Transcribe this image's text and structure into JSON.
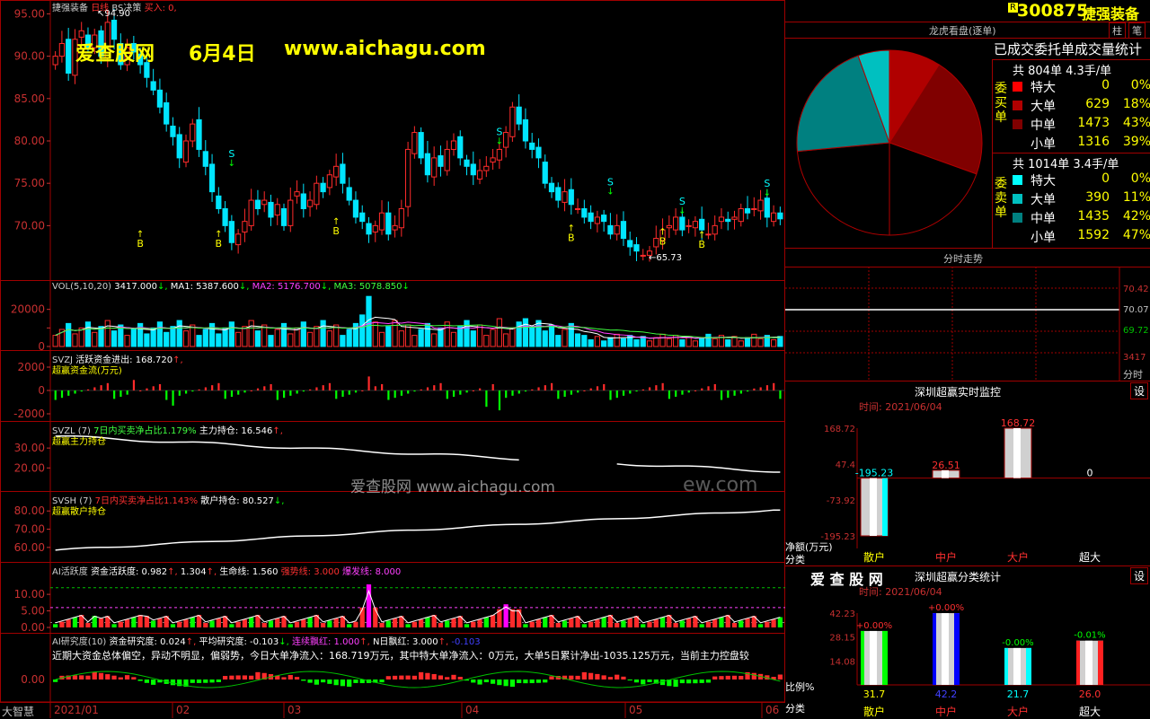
{
  "colors": {
    "up": "#ff2b2b",
    "down": "#00e5ff",
    "frame": "#a00000",
    "axis": "#c83030",
    "yellow": "#ffff00",
    "white": "#ffffff",
    "green": "#00ff00",
    "magenta": "#ff00ff"
  },
  "main": {
    "title": "捷强装备",
    "period": "日线",
    "indicator": "BS决策",
    "buy_label": "买入: 0,",
    "watermark_site": "爱查股网",
    "watermark_date": "6月4日",
    "watermark_url": "www.aichagu.com",
    "high_label": "94.90",
    "low_label": "65.73",
    "y_ticks": [
      "95.00",
      "90.00",
      "85.00",
      "80.00",
      "75.00",
      "70.00"
    ],
    "y_values": [
      95,
      90,
      85,
      80,
      75,
      70
    ],
    "b_marks": [
      [
        13,
        69.5
      ],
      [
        25,
        69.5
      ],
      [
        43,
        71
      ],
      [
        79,
        70.2
      ],
      [
        93,
        69.8
      ],
      [
        99,
        69.4
      ]
    ],
    "s_marks": [
      [
        27,
        76.8
      ],
      [
        68,
        79.4
      ],
      [
        85,
        73.5
      ],
      [
        96,
        71.2
      ],
      [
        109,
        73.3
      ]
    ]
  },
  "chart_data": [
    {
      "type": "candlestick",
      "title": "捷强装备 日线",
      "ylim": [
        64,
        96
      ],
      "closes": [
        90,
        91.5,
        88,
        92,
        93,
        91,
        92.5,
        90,
        94,
        92,
        89,
        91,
        90.5,
        89,
        87.5,
        86,
        84,
        82,
        80.5,
        78,
        80,
        82,
        79,
        77,
        74,
        72,
        70,
        68,
        69,
        70.5,
        73,
        72,
        73,
        71,
        72.5,
        70,
        73,
        74,
        72,
        73,
        75,
        74,
        76,
        77,
        75,
        73,
        71,
        70.5,
        69,
        70,
        71.5,
        69,
        70,
        72,
        79,
        81,
        78,
        76,
        78,
        77,
        79,
        80,
        78,
        77,
        76,
        76.5,
        77,
        78,
        79,
        81,
        84,
        82,
        80,
        79,
        78,
        75,
        74,
        73,
        74,
        72.5,
        72,
        71,
        70.5,
        71,
        70.5,
        69,
        70,
        68.5,
        67.5,
        67,
        66.5,
        67,
        68.5,
        69.5,
        70,
        71,
        69.5,
        70,
        70.5,
        69.5,
        69,
        70,
        71,
        70.5,
        71,
        72,
        71.5,
        72,
        73,
        71,
        71.5,
        70.8
      ]
    },
    {
      "type": "bar",
      "title": "VOL(5,10,20)",
      "ylim": [
        0,
        30000
      ],
      "labels": {
        "vol": "3417.000",
        "ma1": "5387.600",
        "ma2": "5176.700",
        "ma3": "5078.850"
      }
    },
    {
      "type": "bar",
      "title": "SVZJ 活跃资金进出",
      "value": "168.720",
      "ylim": [
        -2500,
        2500
      ]
    },
    {
      "type": "line",
      "title": "SVZL",
      "value": "16.546",
      "ylim": [
        12,
        40
      ]
    },
    {
      "type": "line",
      "title": "SVSH",
      "value": "80.527",
      "ylim": [
        55,
        88
      ]
    },
    {
      "type": "bar",
      "title": "AI活跃度",
      "ylim": [
        0,
        16
      ]
    },
    {
      "type": "bar",
      "title": "AI研究度"
    }
  ],
  "sub": {
    "vol": {
      "name": "VOL(5,10,20)",
      "v": "3417.000",
      "ma1": "MA1: 5387.600",
      "ma2": "MA2: 5176.700",
      "ma3": "MA3: 5078.850",
      "ticks": [
        "20000",
        "10000",
        "0"
      ]
    },
    "svzj": {
      "name": "SVZJ",
      "desc": "活跃资金进出: 168.720",
      "sub": "超赢资金流(万元)",
      "ticks": [
        "2000",
        "0",
        "-2000"
      ]
    },
    "svzl": {
      "name": "SVZL (7)",
      "desc1": "7日内买卖净占比1.179%",
      "desc2": "主力持仓: 16.546",
      "sub": "超赢主力持仓",
      "ticks": [
        "30.00",
        "20.00"
      ]
    },
    "svsh": {
      "name": "SVSH (7)",
      "desc1": "7日内买卖净占比1.143%",
      "desc2": "散户持仓: 80.527",
      "sub": "超赢散户持仓",
      "ticks": [
        "80.00",
        "70.00",
        "60.00"
      ]
    },
    "ai": {
      "name": "AI活跃度",
      "d1": "资金活跃度: 0.982",
      "d2": "1.304",
      "d3": "生命线: 1.560",
      "d4": "强势线: 3.000",
      "d5": "爆发线: 8.000",
      "ticks": [
        "10.00",
        "5.00",
        "0.00"
      ]
    },
    "air": {
      "name": "AI研究度(10)",
      "d1": "资金研究度: 0.024",
      "d2": "平均研究度: -0.103",
      "d3": "连续飘红: 1.000",
      "d4": "N日飘红: 3.000",
      "d5": "-0.103",
      "line2": "近期大资金总体偏空，异动不明显，偏弱势，今日大单净流入：168.719万元，其中特大单净流入：0万元，大单5日累计净出-1035.125万元，当前主力控盘较",
      "ticks": [
        "0.00"
      ]
    },
    "watermark2": "爱查股网  www.aichagu.com",
    "watermark3": "ew.com"
  },
  "xaxis": {
    "start": "2021/01",
    "months": [
      "02",
      "03",
      "04",
      "05",
      "06"
    ]
  },
  "corner_label": "大智慧",
  "right": {
    "code": "300875",
    "name": "捷强装备",
    "r_badge": "R",
    "btn1": "柱",
    "btn2": "笔",
    "pie_title": "龙虎看盘(逐单)",
    "stat_title": "已成交委托单成交量统计",
    "buy_label": "委买单",
    "sell_label": "委卖单",
    "buy_total": "共 804单 4.3手/单",
    "sell_total": "共 1014单 3.4手/单",
    "buy_rows": [
      {
        "name": "特大",
        "n": "0",
        "p": "0%",
        "c": "#ff0000"
      },
      {
        "name": "大单",
        "n": "629",
        "p": "18%",
        "c": "#b00000"
      },
      {
        "name": "中单",
        "n": "1473",
        "p": "43%",
        "c": "#800000"
      },
      {
        "name": "小单",
        "n": "1316",
        "p": "39%",
        "c": "#000000"
      }
    ],
    "sell_rows": [
      {
        "name": "特大",
        "n": "0",
        "p": "0%",
        "c": "#00ffff"
      },
      {
        "name": "大单",
        "n": "390",
        "p": "11%",
        "c": "#00c0c0"
      },
      {
        "name": "中单",
        "n": "1435",
        "p": "42%",
        "c": "#008080"
      },
      {
        "name": "小单",
        "n": "1592",
        "p": "47%",
        "c": "#000000"
      }
    ],
    "intraday_title": "分时走势",
    "intraday_ticks": [
      "70.42",
      "70.07",
      "69.72"
    ],
    "intraday_vol": "3417",
    "intraday_unit": "分时",
    "monitor_title": "深圳超赢实时监控",
    "monitor_btn": "设",
    "monitor_time": "时间: 2021/06/04",
    "monitor_ticks": [
      "168.72",
      "47.4",
      "-73.92",
      "-195.23"
    ],
    "monitor_unit": "净额(万元)",
    "monitor_cat": "分类",
    "monitor_bars": [
      {
        "label": "散户",
        "v": -195.23,
        "t": "-195.23"
      },
      {
        "label": "中户",
        "v": 26.51,
        "t": "26.51"
      },
      {
        "label": "大户",
        "v": 168.72,
        "t": "168.72"
      },
      {
        "label": "超大",
        "v": 0,
        "t": "0"
      }
    ],
    "class_site": "爱 查 股 网",
    "class_title": "深圳超赢分类统计",
    "class_btn": "设",
    "class_time": "时间: 2021/06/04",
    "class_ticks": [
      "42.23",
      "28.15",
      "14.08"
    ],
    "class_ratio": "比例%",
    "class_cat": "分类",
    "class_bars": [
      {
        "label": "散户",
        "v": 31.7,
        "t": "31.7",
        "d": "+0.00%",
        "c": "#00ff00"
      },
      {
        "label": "中户",
        "v": 42.2,
        "t": "42.2",
        "d": "+0.00%",
        "c": "#0000ff"
      },
      {
        "label": "大户",
        "v": 21.7,
        "t": "21.7",
        "d": "-0.00%",
        "c": "#00ffff"
      },
      {
        "label": "超大",
        "v": 26.0,
        "t": "26.0",
        "d": "-0.01%",
        "c": "#ff2020"
      }
    ]
  }
}
